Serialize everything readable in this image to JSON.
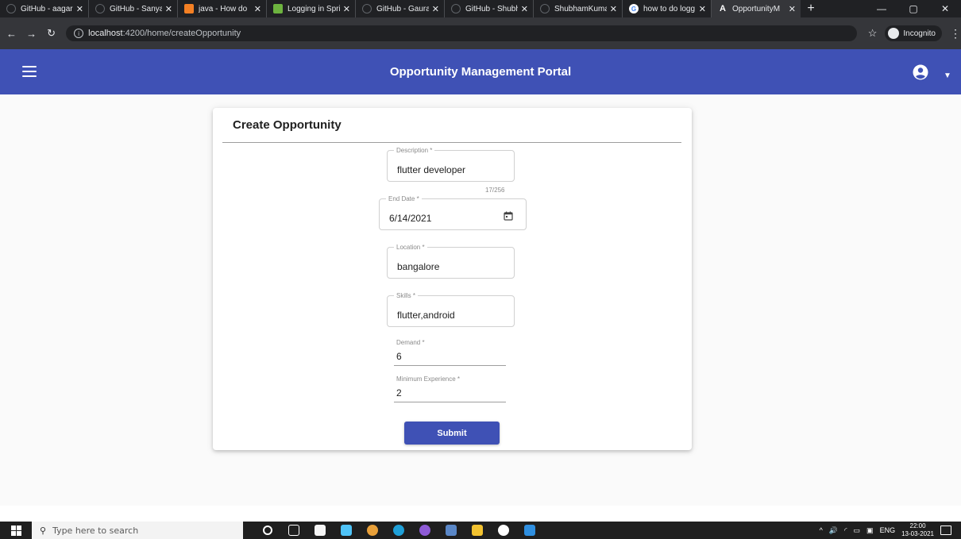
{
  "browser": {
    "tabs": [
      {
        "label": "GitHub - aagar",
        "favicon": "github-icon"
      },
      {
        "label": "GitHub - Sanya",
        "favicon": "github-icon"
      },
      {
        "label": "java - How do",
        "favicon": "stackoverflow-icon"
      },
      {
        "label": "Logging in Spri",
        "favicon": "spring-icon"
      },
      {
        "label": "GitHub - Gaura",
        "favicon": "github-icon"
      },
      {
        "label": "GitHub - Shubh",
        "favicon": "github-icon"
      },
      {
        "label": "ShubhamKuma",
        "favicon": "github-icon"
      },
      {
        "label": "how to do logg",
        "favicon": "google-icon"
      },
      {
        "label": "OpportunityM",
        "favicon": "angular-icon",
        "active": true
      }
    ],
    "address": {
      "host": "localhost",
      "path": ":4200/home/createOpportunity"
    },
    "incognito_label": "Incognito"
  },
  "app": {
    "title": "Opportunity Management Portal",
    "accent": "#3f51b5"
  },
  "form": {
    "title": "Create Opportunity",
    "fields": {
      "description": {
        "label": "Description *",
        "value": "flutter developer",
        "hint": "17/256"
      },
      "end_date": {
        "label": "End Date *",
        "value": "6/14/2021"
      },
      "location": {
        "label": "Location *",
        "value": "bangalore"
      },
      "skills": {
        "label": "Skills *",
        "value": "flutter,android"
      },
      "demand": {
        "label": "Demand *",
        "value": "6"
      },
      "min_experience": {
        "label": "Minimum Experience *",
        "value": "2"
      }
    },
    "submit_label": "Submit"
  },
  "taskbar": {
    "search_placeholder": "Type here to search",
    "language": "ENG",
    "time": "22:00",
    "date": "13-03-2021"
  }
}
